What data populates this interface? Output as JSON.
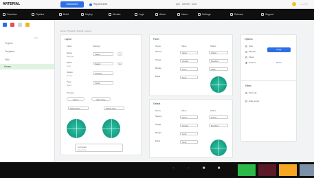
{
  "chrome": {
    "logo": "ARTERIAL",
    "active_tab": "Dashboard",
    "tab2": "Reports area",
    "address": "app · arterial · local",
    "window_controls": "— ▢ ×"
  },
  "toolbar": {
    "items": [
      "Overview",
      "Pipeline",
      "Build",
      "Deploy",
      "Monitor",
      "Logs",
      "Alerts",
      "Users",
      "Settings",
      "Release",
      "Support"
    ]
  },
  "sidebar": {
    "sub_label": "edit",
    "items": [
      "Projects",
      "Templates",
      "Files",
      "Library"
    ]
  },
  "breadcrumb": "Home  /  Projects  /  Arterial  /  Layout",
  "card_left": {
    "title": "Layout",
    "col1": "Label",
    "col2": "Settings",
    "rows": [
      {
        "a": "Name",
        "b": "Sample",
        "c": "Value",
        "d": "On"
      },
      {
        "a": "Mode",
        "b": "Auto",
        "c": "Select",
        "d": "Set"
      },
      {
        "a": "Option",
        "b": "Group",
        "c": "Choose",
        "d": ""
      },
      {
        "a": "Type",
        "b": "Basic",
        "c": "Fixed",
        "d": ""
      }
    ],
    "section_label": "Preview",
    "pill1": "Open",
    "pill2": "Edit value",
    "sel_a": "Select item",
    "sel_b": "Select item",
    "foot_label": "Comment",
    "foot_sub": "type here"
  },
  "card_mid_top": {
    "title": "Panel",
    "col1": "Name",
    "col2": "Value",
    "col3": "Status",
    "rows": [
      {
        "a": "Source",
        "b": "Input",
        "c": "Active"
      },
      {
        "a": "Target",
        "b": "Output",
        "c": "Pending"
      },
      {
        "a": "Range",
        "b": "Limit",
        "c": "Valid"
      },
      {
        "a": "Extra",
        "b": "Note",
        "c": "Done"
      }
    ]
  },
  "card_mid_bottom": {
    "title": "Details",
    "col1": "Name",
    "col2": "Value",
    "col3": "Status",
    "rows": [
      {
        "a": "Source",
        "b": "Input",
        "c": "Active"
      },
      {
        "a": "Target",
        "b": "Output",
        "c": "Pending"
      },
      {
        "a": "Range",
        "b": "Limit",
        "c": "Valid"
      },
      {
        "a": "Extra",
        "b": "Note",
        "c": "Done"
      }
    ]
  },
  "right_panel": {
    "title": "Options",
    "options": [
      "Auto",
      "Manual",
      "Fixed",
      "Custom"
    ],
    "primary_button": "Apply",
    "link": "Reset",
    "section2": "Filters",
    "filters": [
      "Show all",
      "Hide empty"
    ]
  },
  "colors": {
    "accent": "#2d6ee8",
    "teal": "#1aa58a",
    "dock_green": "#2db84a",
    "dock_maroon": "#5a1a28",
    "dock_orange": "#f5a623",
    "dock_gray": "#7e8fa8"
  }
}
